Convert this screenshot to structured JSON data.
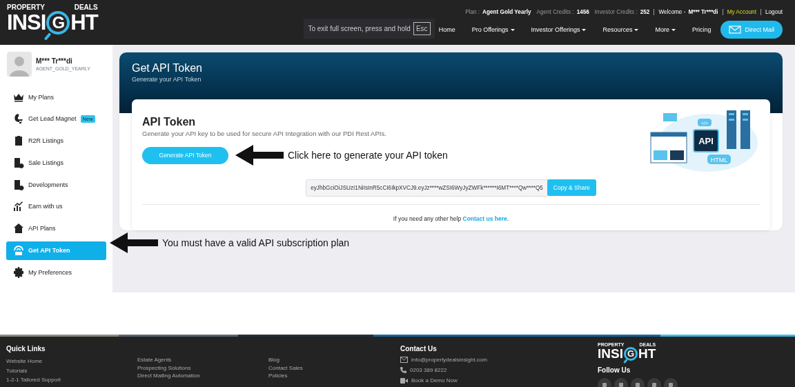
{
  "logo": {
    "top_left": "PROPERTY",
    "top_right": "DEALS",
    "word_start": "INSI",
    "word_ring": "G",
    "word_end": "HT"
  },
  "account_bar": {
    "plan_label": "Plan :",
    "plan": "Agent Gold Yearly",
    "agent_credits_label": "Agent Credits :",
    "agent_credits": "1456",
    "investor_credits_label": "Investor Credits :",
    "investor_credits": "252",
    "welcome": "Welcome -",
    "user": "M*** Tr***di",
    "my_account": "My Account",
    "logout": "Logout"
  },
  "fullscreen_notice": {
    "text": "To exit full screen, press and hold",
    "key": "Esc"
  },
  "nav": [
    {
      "label": "Home",
      "has_menu": false
    },
    {
      "label": "Pro Offerings",
      "has_menu": true
    },
    {
      "label": "Investor Offerings",
      "has_menu": true
    },
    {
      "label": "Resources",
      "has_menu": true
    },
    {
      "label": "More",
      "has_menu": true
    },
    {
      "label": "Pricing",
      "has_menu": false
    }
  ],
  "direct_mail_button": "Direct Mail",
  "profile": {
    "name": "M*** Tr***di",
    "plan": "AGENT_GOLD_YEARLY"
  },
  "sidebar": {
    "items": [
      {
        "label": "My Plans",
        "selected": false
      },
      {
        "label": "Get Lead Magnet",
        "selected": false,
        "badge": "New"
      },
      {
        "label": "R2R Listings",
        "selected": false
      },
      {
        "label": "Sale Listings",
        "selected": false
      },
      {
        "label": "Developments",
        "selected": false
      },
      {
        "label": "Earn with us",
        "selected": false
      },
      {
        "label": "API Plans",
        "selected": false
      },
      {
        "label": "Get API Token",
        "selected": true
      },
      {
        "label": "My Preferences",
        "selected": false
      }
    ]
  },
  "page_header": {
    "title": "Get API Token",
    "subtitle": "Generate your API Token"
  },
  "card": {
    "title": "API Token",
    "description": "Generate your API key to be used for secure API Integration with our PDI Rest APIs.",
    "generate_button": "Generate API Token",
    "token": "eyJhbGciOiJSUzI1NiIsInR5cCI6IkpXVCJ9.eyJz****wZSI6WyJyZWFk******I6MT****Qw****Q5",
    "copy_button": "Copy & Share",
    "help_text": "If you need any other help",
    "help_link": "Contact us here",
    "help_end": "."
  },
  "illustration": {
    "code_label": "</>",
    "chip_label": "API",
    "tag_label": "HTML"
  },
  "annotations": [
    {
      "text": "Click here to generate your API token"
    },
    {
      "text": "You must have a valid API subscription plan"
    }
  ],
  "footer": {
    "quick_links_title": "Quick Links",
    "link_columns": [
      [
        "Website Home",
        "Tutorials",
        "1-2-1 Tailored Support"
      ],
      [
        "Estate Agents",
        "Prospecting Solutions",
        "Direct Mailing Automation"
      ],
      [
        "Blog",
        "Contact Sales",
        "Policies"
      ]
    ],
    "contact_title": "Contact Us",
    "email": "info@propertydealsinsight.com",
    "phone": "0203 389 8222",
    "demo": "Book a Demo Now",
    "logo": {
      "top_left": "PROPERTY",
      "top_right": "DEALS",
      "word_start": "INSI",
      "word_ring": "G",
      "word_end": "HT"
    },
    "follow_title": "Follow Us"
  }
}
